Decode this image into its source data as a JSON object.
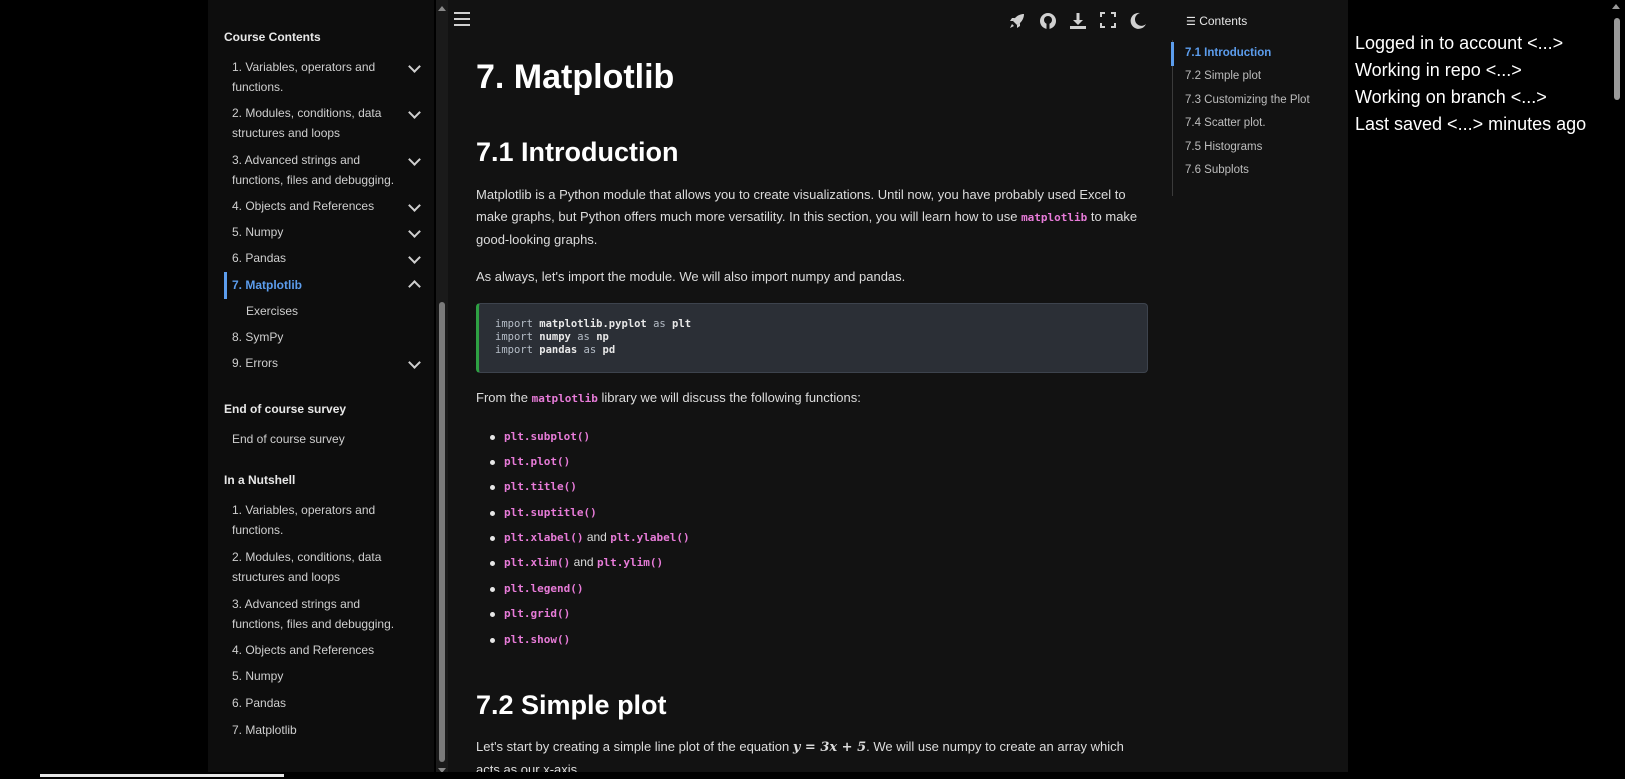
{
  "sidebar": {
    "section_course": "Course Contents",
    "course_items": [
      {
        "label": "1. Variables, operators and functions."
      },
      {
        "label": "2. Modules, conditions, data structures and loops"
      },
      {
        "label": "3. Advanced strings and functions, files and debugging."
      },
      {
        "label": "4. Objects and References"
      },
      {
        "label": "5. Numpy"
      },
      {
        "label": "6. Pandas"
      },
      {
        "label": "7. Matplotlib"
      },
      {
        "label": "Exercises"
      },
      {
        "label": "8. SymPy"
      },
      {
        "label": "9. Errors"
      }
    ],
    "section_survey": "End of course survey",
    "survey_item": "End of course survey",
    "section_nutshell": "In a Nutshell",
    "nutshell_items": [
      {
        "label": "1. Variables, operators and functions."
      },
      {
        "label": "2. Modules, conditions, data structures and loops"
      },
      {
        "label": "3. Advanced strings and functions, files and debugging."
      },
      {
        "label": "4. Objects and References"
      },
      {
        "label": "5. Numpy"
      },
      {
        "label": "6. Pandas"
      },
      {
        "label": "7. Matplotlib"
      }
    ],
    "accent": "#5c9ded"
  },
  "toolbar": {
    "icons": [
      "menu-icon",
      "rocket-icon",
      "github-icon",
      "download-icon",
      "fullscreen-icon",
      "moon-icon"
    ]
  },
  "main": {
    "title": "7. Matplotlib",
    "intro_heading": "7.1 Introduction",
    "intro_p1_a": "Matplotlib is a Python module that allows you to create visualizations. Until now, you have probably used Excel to make graphs, but Python offers much more versatility. In this section, you will learn how to use ",
    "intro_p1_code": "matplotlib",
    "intro_p1_b": " to make good-looking graphs.",
    "intro_p2": "As always, let's import the module. We will also import numpy and pandas.",
    "code_lines": [
      {
        "kw": "import",
        "mod": "matplotlib.pyplot",
        "as": "as",
        "alias": "plt"
      },
      {
        "kw": "import",
        "mod": "numpy",
        "as": "as",
        "alias": "np"
      },
      {
        "kw": "import",
        "mod": "pandas",
        "as": "as",
        "alias": "pd"
      }
    ],
    "functions_intro_a": "From the ",
    "functions_intro_code": "matplotlib",
    "functions_intro_b": " library we will discuss the following functions:",
    "functions": [
      {
        "a": "plt.subplot()",
        "join": "",
        "b": ""
      },
      {
        "a": "plt.plot()",
        "join": "",
        "b": ""
      },
      {
        "a": "plt.title()",
        "join": "",
        "b": ""
      },
      {
        "a": "plt.suptitle()",
        "join": "",
        "b": ""
      },
      {
        "a": "plt.xlabel()",
        "join": " and ",
        "b": "plt.ylabel()"
      },
      {
        "a": "plt.xlim()",
        "join": " and ",
        "b": "plt.ylim()"
      },
      {
        "a": "plt.legend()",
        "join": "",
        "b": ""
      },
      {
        "a": "plt.grid()",
        "join": "",
        "b": ""
      },
      {
        "a": "plt.show()",
        "join": "",
        "b": ""
      }
    ],
    "simple_heading": "7.2 Simple plot",
    "simple_p_a": "Let's start by creating a simple line plot of the equation ",
    "simple_p_eq": "y = 3x + 5",
    "simple_p_b": ". We will use numpy to create an array which acts as our x-axis",
    "inline_code_color": "#e77bd8"
  },
  "toc": {
    "title": "Contents",
    "items": [
      {
        "label": "7.1 Introduction"
      },
      {
        "label": "7.2 Simple plot"
      },
      {
        "label": "7.3 Customizing the Plot"
      },
      {
        "label": "7.4 Scatter plot."
      },
      {
        "label": "7.5 Histograms"
      },
      {
        "label": "7.6 Subplots"
      }
    ]
  },
  "status": {
    "account": "Logged in to account <...>",
    "repo": "Working in repo <...>",
    "branch": "Working on branch <...>",
    "saved": "Last saved <...> minutes ago"
  }
}
